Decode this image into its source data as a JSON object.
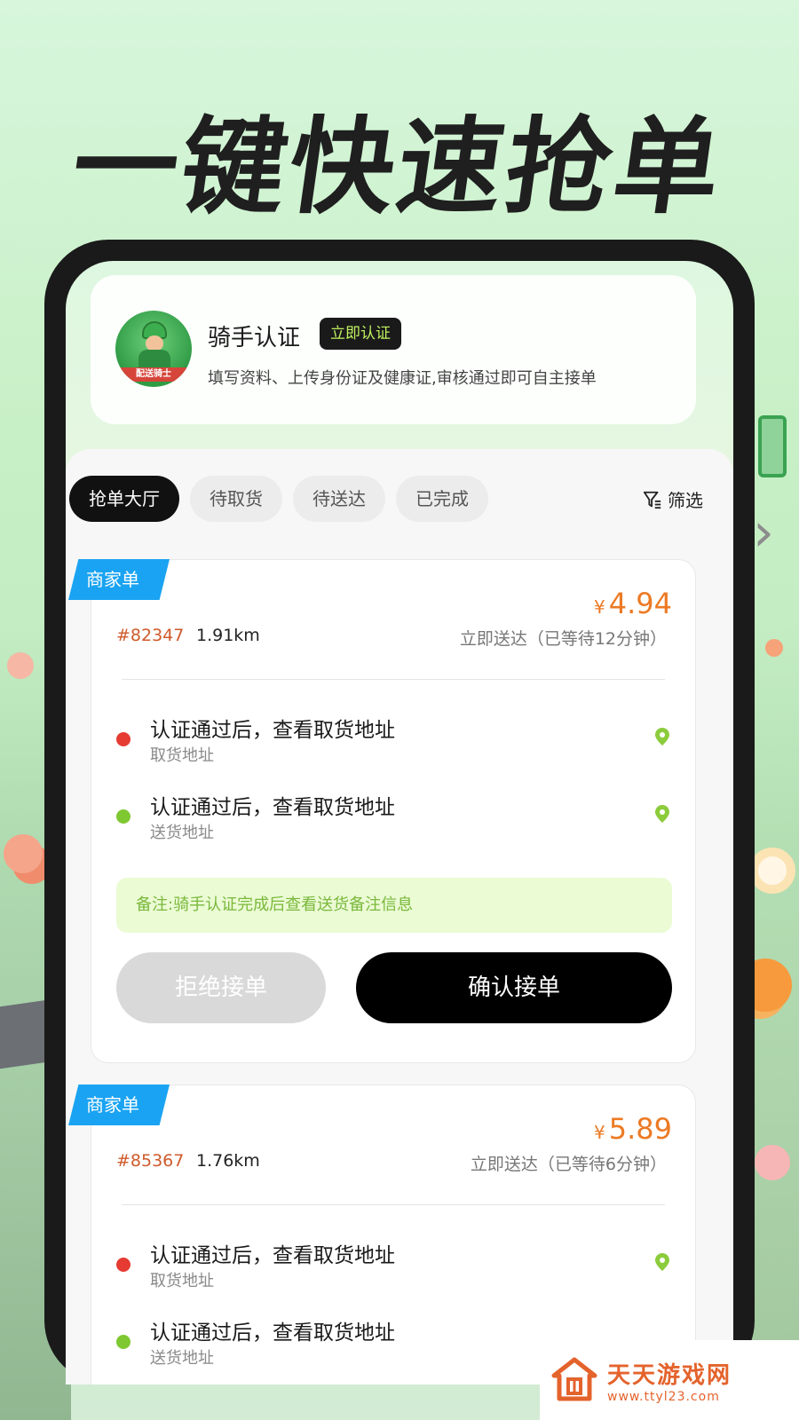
{
  "headline": "一键快速抢单",
  "auth": {
    "title": "骑手认证",
    "badge": "立即认证",
    "description": "填写资料、上传身份证及健康证,审核通过即可自主接单",
    "avatar_ribbon": "配送骑士"
  },
  "tabs": [
    {
      "label": "抢单大厅",
      "active": true
    },
    {
      "label": "待取货",
      "active": false
    },
    {
      "label": "待送达",
      "active": false
    },
    {
      "label": "已完成",
      "active": false
    }
  ],
  "filter_label": "筛选",
  "orders": [
    {
      "tag": "商家单",
      "currency": "¥",
      "price": "4.94",
      "id": "#82347",
      "distance": "1.91km",
      "wait": "立即送达（已等待12分钟）",
      "pickup_main": "认证通过后，查看取货地址",
      "pickup_sub": "取货地址",
      "delivery_main": "认证通过后，查看取货地址",
      "delivery_sub": "送货地址",
      "remark": "备注:骑手认证完成后查看送货备注信息",
      "reject_label": "拒绝接单",
      "confirm_label": "确认接单"
    },
    {
      "tag": "商家单",
      "currency": "¥",
      "price": "5.89",
      "id": "#85367",
      "distance": "1.76km",
      "wait": "立即送达（已等待6分钟）",
      "pickup_main": "认证通过后，查看取货地址",
      "pickup_sub": "取货地址",
      "delivery_main": "认证通过后，查看取货地址",
      "delivery_sub": "送货地址"
    }
  ],
  "watermark": {
    "title": "天天游戏网",
    "url": "www.ttyl23.com"
  },
  "colors": {
    "accent_orange": "#ec7a24",
    "tag_blue": "#1aa3f2",
    "badge_green": "#bff05e",
    "remark_bg": "#ebfbd4",
    "dot_red": "#e53b33",
    "dot_green": "#7fc832"
  }
}
